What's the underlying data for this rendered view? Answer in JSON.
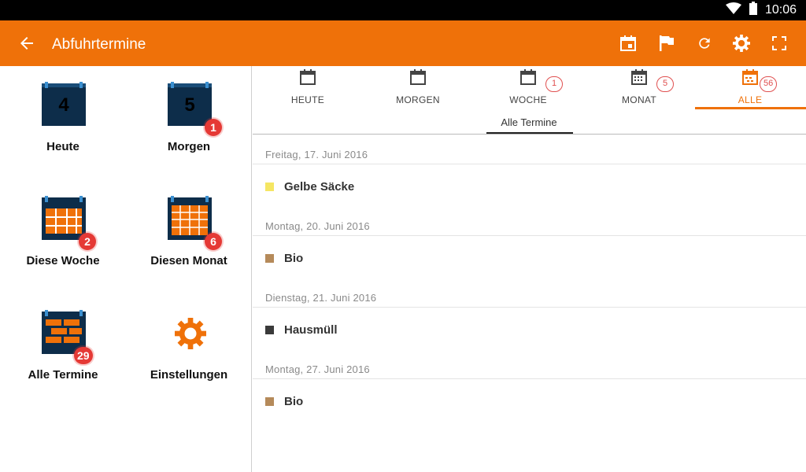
{
  "status": {
    "time": "10:06",
    "icons": [
      "wifi-icon",
      "battery-icon"
    ]
  },
  "appbar": {
    "title": "Abfuhrtermine",
    "background": "#ef7109",
    "icons": [
      "back-arrow-icon",
      "calendar-today-icon",
      "flag-icon",
      "refresh-icon",
      "settings-icon",
      "fullscreen-icon"
    ]
  },
  "tiles": [
    {
      "label": "Heute",
      "day": "4",
      "badge": ""
    },
    {
      "label": "Morgen",
      "day": "5",
      "badge": "1"
    },
    {
      "label": "Diese Woche",
      "badge": "2"
    },
    {
      "label": "Diesen Monat",
      "badge": "6"
    },
    {
      "label": "Alle Termine",
      "badge": "29"
    },
    {
      "label": "Einstellungen",
      "badge": ""
    }
  ],
  "tabs": [
    {
      "label": "HEUTE",
      "badge": ""
    },
    {
      "label": "MORGEN",
      "badge": ""
    },
    {
      "label": "WOCHE",
      "badge": "1"
    },
    {
      "label": "MONAT",
      "badge": "5"
    },
    {
      "label": "ALLE",
      "badge": "56"
    }
  ],
  "active_tab": "ALLE",
  "subtab": "Alle Termine",
  "entries": [
    {
      "date": "Freitag, 17. Juni 2016",
      "item": "Gelbe Säcke",
      "color": "#f5e663"
    },
    {
      "date": "Montag, 20. Juni 2016",
      "item": "Bio",
      "color": "#b58a5a"
    },
    {
      "date": "Dienstag, 21. Juni 2016",
      "item": "Hausmüll",
      "color": "#3a3a3a"
    },
    {
      "date": "Montag, 27. Juni 2016",
      "item": "Bio",
      "color": "#b58a5a"
    }
  ]
}
